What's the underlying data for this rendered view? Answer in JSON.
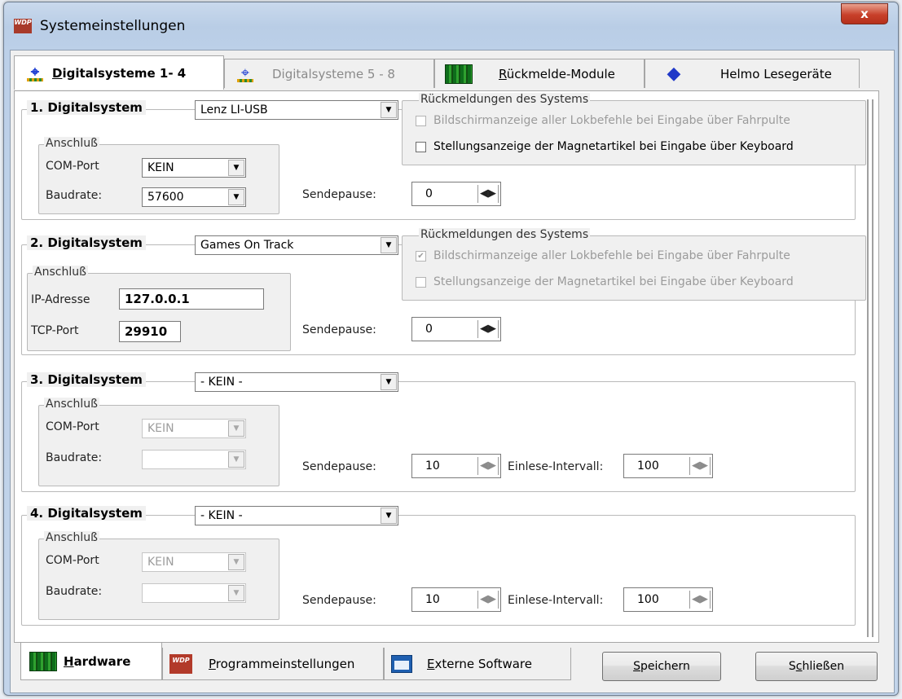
{
  "window": {
    "title": "Systemeinstellungen",
    "close": "x",
    "app_icon": "WDP"
  },
  "tabs_top": [
    {
      "label_u": "D",
      "label_rest": "igitalsysteme 1- 4",
      "icon": "rail-icon",
      "active": true
    },
    {
      "label_pre": "Di",
      "label_u": "g",
      "label_rest": "italsysteme 5 - 8",
      "icon": "rail-icon",
      "active": false
    },
    {
      "label_u": "R",
      "label_rest": "ückmelde-Module",
      "icon": "circuit-board-icon",
      "active": false
    },
    {
      "label": "Helmo Lesegeräte",
      "icon": "helmo-diamond-icon",
      "active": false
    }
  ],
  "systems": [
    {
      "title": "1. Digitalsystem",
      "device": "Lenz LI-USB",
      "anschluss_title": "Anschluß",
      "row1_label": "COM-Port",
      "row1_value": "KEIN",
      "row2_label": "Baudrate:",
      "row2_value": "57600",
      "feedback_title": "Rückmeldungen des Systems",
      "fb1": "Bildschirmanzeige aller Lokbefehle bei Eingabe über Fahrpulte",
      "fb2": "Stellungsanzeige der Magnetartikel bei Eingabe über Keyboard",
      "sendepause_label": "Sendepause:",
      "sendepause": "0"
    },
    {
      "title": "2. Digitalsystem",
      "device": "Games On Track",
      "anschluss_title": "Anschluß",
      "row1_label": "IP-Adresse",
      "row1_value": "127.0.0.1",
      "row2_label": "TCP-Port",
      "row2_value": "29910",
      "feedback_title": "Rückmeldungen des Systems",
      "fb1": "Bildschirmanzeige aller Lokbefehle bei Eingabe über Fahrpulte",
      "fb2": "Stellungsanzeige der Magnetartikel bei Eingabe über Keyboard",
      "sendepause_label": "Sendepause:",
      "sendepause": "0"
    },
    {
      "title": "3. Digitalsystem",
      "device": "- KEIN -",
      "anschluss_title": "Anschluß",
      "row1_label": "COM-Port",
      "row1_value": "KEIN",
      "row2_label": "Baudrate:",
      "row2_value": "",
      "sendepause_label": "Sendepause:",
      "sendepause": "10",
      "einlese_label": "Einlese-Intervall:",
      "einlese": "100"
    },
    {
      "title": "4. Digitalsystem",
      "device": "- KEIN -",
      "anschluss_title": "Anschluß",
      "row1_label": "COM-Port",
      "row1_value": "KEIN",
      "row2_label": "Baudrate:",
      "row2_value": "",
      "sendepause_label": "Sendepause:",
      "sendepause": "10",
      "einlese_label": "Einlese-Intervall:",
      "einlese": "100"
    }
  ],
  "tabs_bottom": [
    {
      "label_u": "H",
      "label_rest": "ardware",
      "icon": "circuit-board-icon",
      "active": true
    },
    {
      "label_u": "P",
      "label_rest": "rogrammeinstellungen",
      "icon": "wdp-logo-icon",
      "active": false
    },
    {
      "label_u": "E",
      "label_rest": "xterne Software",
      "icon": "window-icon",
      "active": false
    }
  ],
  "buttons": {
    "save_u": "S",
    "save_rest": "peichern",
    "close_pre": "S",
    "close_u": "c",
    "close_rest": "hließen"
  }
}
